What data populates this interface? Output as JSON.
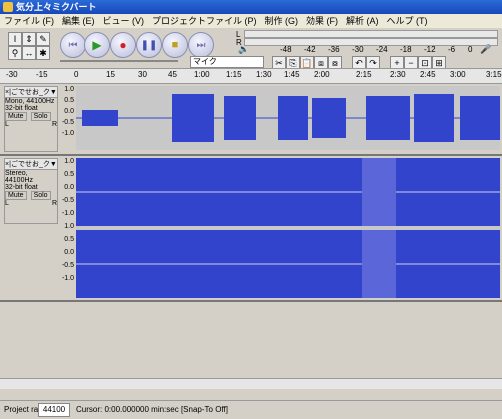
{
  "window": {
    "title": "気分上々ミクバート"
  },
  "menu": [
    "ファイル (F)",
    "編集 (E)",
    "ビュー (V)",
    "プロジェクトファイル (P)",
    "制作 (G)",
    "効果 (F)",
    "解析 (A)",
    "ヘルプ (T)"
  ],
  "meter": {
    "left_label": "L",
    "right_label": "R",
    "ticks": [
      "-48",
      "-42",
      "-36",
      "-30",
      "-24",
      "-18",
      "-12",
      "-6",
      "0"
    ]
  },
  "mixer": {
    "input_label": "マイク"
  },
  "ruler": {
    "labels": [
      "-30",
      "-15",
      "0",
      "15",
      "30",
      "45",
      "1:00",
      "1:15",
      "1:30",
      "1:45",
      "2:00",
      "2:15",
      "2:30",
      "2:45",
      "3:00",
      "3:15"
    ]
  },
  "tracks": [
    {
      "name": "×|ごでせお_ク▼",
      "format": "Mono, 44100Hz",
      "bit": "32-bit float",
      "mute": "Mute",
      "solo": "Solo",
      "l": "L",
      "r": "R",
      "scale": [
        "1.0",
        "0.5",
        "0.0",
        "-0.5",
        "-1.0"
      ]
    },
    {
      "name": "×|ごでせお_ク▼",
      "format": "Stereo, 44100Hz",
      "bit": "32-bit float",
      "mute": "Mute",
      "solo": "Solo",
      "l": "L",
      "r": "R",
      "scale": [
        "1.0",
        "0.5",
        "0.0",
        "-0.5",
        "-1.0",
        "1.0",
        "0.5",
        "0.0",
        "-0.5",
        "-1.0"
      ]
    }
  ],
  "status": {
    "rate_label": "Project rate:",
    "rate_value": "44100",
    "cursor": "Cursor: 0:00.000000 min:sec  [Snap-To Off]"
  },
  "colors": {
    "wave": "#3344cc",
    "wave_bg": "#c8c8c8",
    "title_bg": "#1e56c8"
  }
}
